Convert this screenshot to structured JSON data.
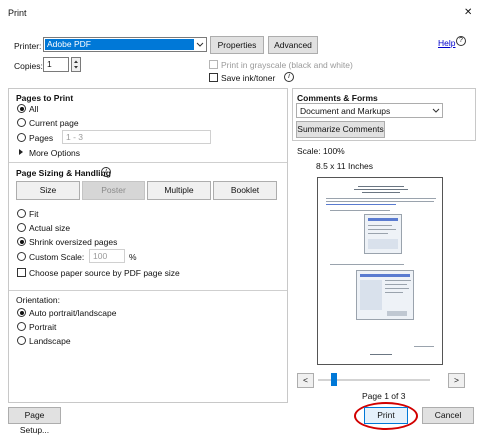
{
  "window": {
    "title": "Print",
    "close_glyph": "✕"
  },
  "header": {
    "printer_label": "Printer:",
    "printer_value": "Adobe PDF",
    "properties_label": "Properties",
    "advanced_label": "Advanced",
    "help_label": "Help",
    "copies_label": "Copies:",
    "copies_value": "1",
    "grayscale_label": "Print in grayscale (black and white)",
    "save_ink_label": "Save ink/toner"
  },
  "pages_to_print": {
    "title": "Pages to Print",
    "all_label": "All",
    "current_label": "Current page",
    "pages_label": "Pages",
    "pages_value": "1 - 3",
    "more_options_label": "More Options"
  },
  "sizing": {
    "title": "Page Sizing & Handling",
    "tabs": [
      "Size",
      "Poster",
      "Multiple",
      "Booklet"
    ],
    "fit_label": "Fit",
    "actual_label": "Actual size",
    "shrink_label": "Shrink oversized pages",
    "custom_label": "Custom Scale:",
    "custom_value": "100",
    "percent": "%",
    "paper_source_label": "Choose paper source by PDF page size"
  },
  "orientation": {
    "title": "Orientation:",
    "auto_label": "Auto portrait/landscape",
    "portrait_label": "Portrait",
    "landscape_label": "Landscape"
  },
  "comments": {
    "title": "Comments & Forms",
    "select_value": "Document and Markups",
    "summarize_label": "Summarize Comments"
  },
  "preview": {
    "scale": "Scale: 100%",
    "paper": "8.5 x 11 Inches",
    "page_counter": "Page 1 of 3",
    "prev": "<",
    "next": ">"
  },
  "footer": {
    "page_setup_label": "Page Setup...",
    "print_label": "Print",
    "cancel_label": "Cancel"
  },
  "colors": {
    "accent": "#0078d7",
    "highlight_ring": "#d10000"
  }
}
